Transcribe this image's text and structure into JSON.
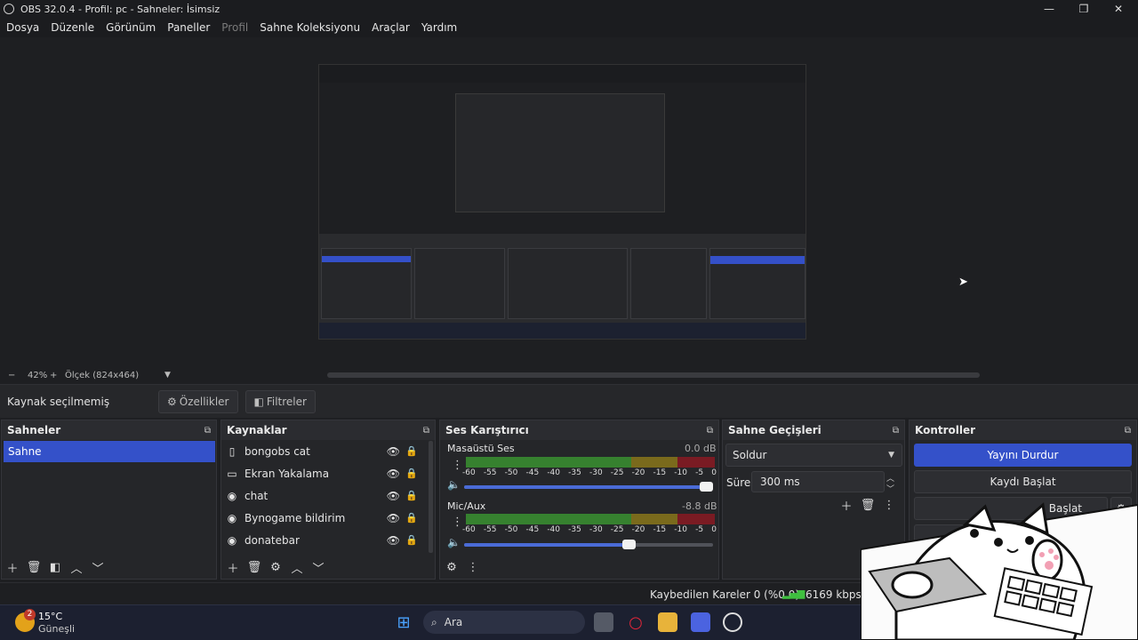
{
  "window": {
    "title": "OBS 32.0.4 - Profil: pc - Sahneler: İsimsiz",
    "minimize": "—",
    "maximize": "❐",
    "close": "✕"
  },
  "menu": [
    {
      "label": "Dosya",
      "enabled": true
    },
    {
      "label": "Düzenle",
      "enabled": true
    },
    {
      "label": "Görünüm",
      "enabled": true
    },
    {
      "label": "Paneller",
      "enabled": true
    },
    {
      "label": "Profil",
      "enabled": false
    },
    {
      "label": "Sahne Koleksiyonu",
      "enabled": true
    },
    {
      "label": "Araçlar",
      "enabled": true
    },
    {
      "label": "Yardım",
      "enabled": true
    }
  ],
  "zoom": {
    "minus": "−",
    "value": "42%",
    "plus": "+",
    "scale": "Ölçek (824x464)"
  },
  "source_bar": {
    "no_selection": "Kaynak seçilmemiş",
    "properties": "Özellikler",
    "filters": "Filtreler"
  },
  "docks": {
    "scenes": {
      "title": "Sahneler",
      "items": [
        "Sahne"
      ]
    },
    "sources": {
      "title": "Kaynaklar",
      "items": [
        {
          "name": "bongobs cat",
          "icon": "file-icon"
        },
        {
          "name": "Ekran Yakalama",
          "icon": "monitor-icon"
        },
        {
          "name": "chat",
          "icon": "globe-icon"
        },
        {
          "name": "Bynogame bildirim",
          "icon": "globe-icon"
        },
        {
          "name": "donatebar",
          "icon": "globe-icon"
        }
      ]
    },
    "mixer": {
      "title": "Ses Karıştırıcı",
      "ticks": [
        "-60",
        "-55",
        "-50",
        "-45",
        "-40",
        "-35",
        "-30",
        "-25",
        "-20",
        "-15",
        "-10",
        "-5",
        "0"
      ],
      "channels": [
        {
          "name": "Masaüstü Ses",
          "db": "0.0 dB",
          "volume": 1.0
        },
        {
          "name": "Mic/Aux",
          "db": "-8.8 dB",
          "volume": 0.67
        }
      ]
    },
    "transitions": {
      "title": "Sahne Geçişleri",
      "selected": "Soldur",
      "duration_label": "Süre",
      "duration_value": "300 ms"
    },
    "controls": {
      "title": "Kontroller",
      "stop_stream": "Yayını Durdur",
      "start_record": "Kaydı Başlat",
      "start_replay": "Başlat"
    }
  },
  "status": {
    "dropped_frames": "Kaybedilen Kareler 0 (%0.0)",
    "bitrate": "6169 kbps"
  },
  "taskbar": {
    "weather_temp": "15°C",
    "weather_desc": "Güneşli",
    "badge": "2",
    "search_placeholder": "Ara"
  },
  "colors": {
    "accent": "#3451c9",
    "background": "#1e1f22",
    "meter_green": "#36812f",
    "meter_yellow": "#7a6a1c",
    "meter_red": "#7a1b23"
  }
}
